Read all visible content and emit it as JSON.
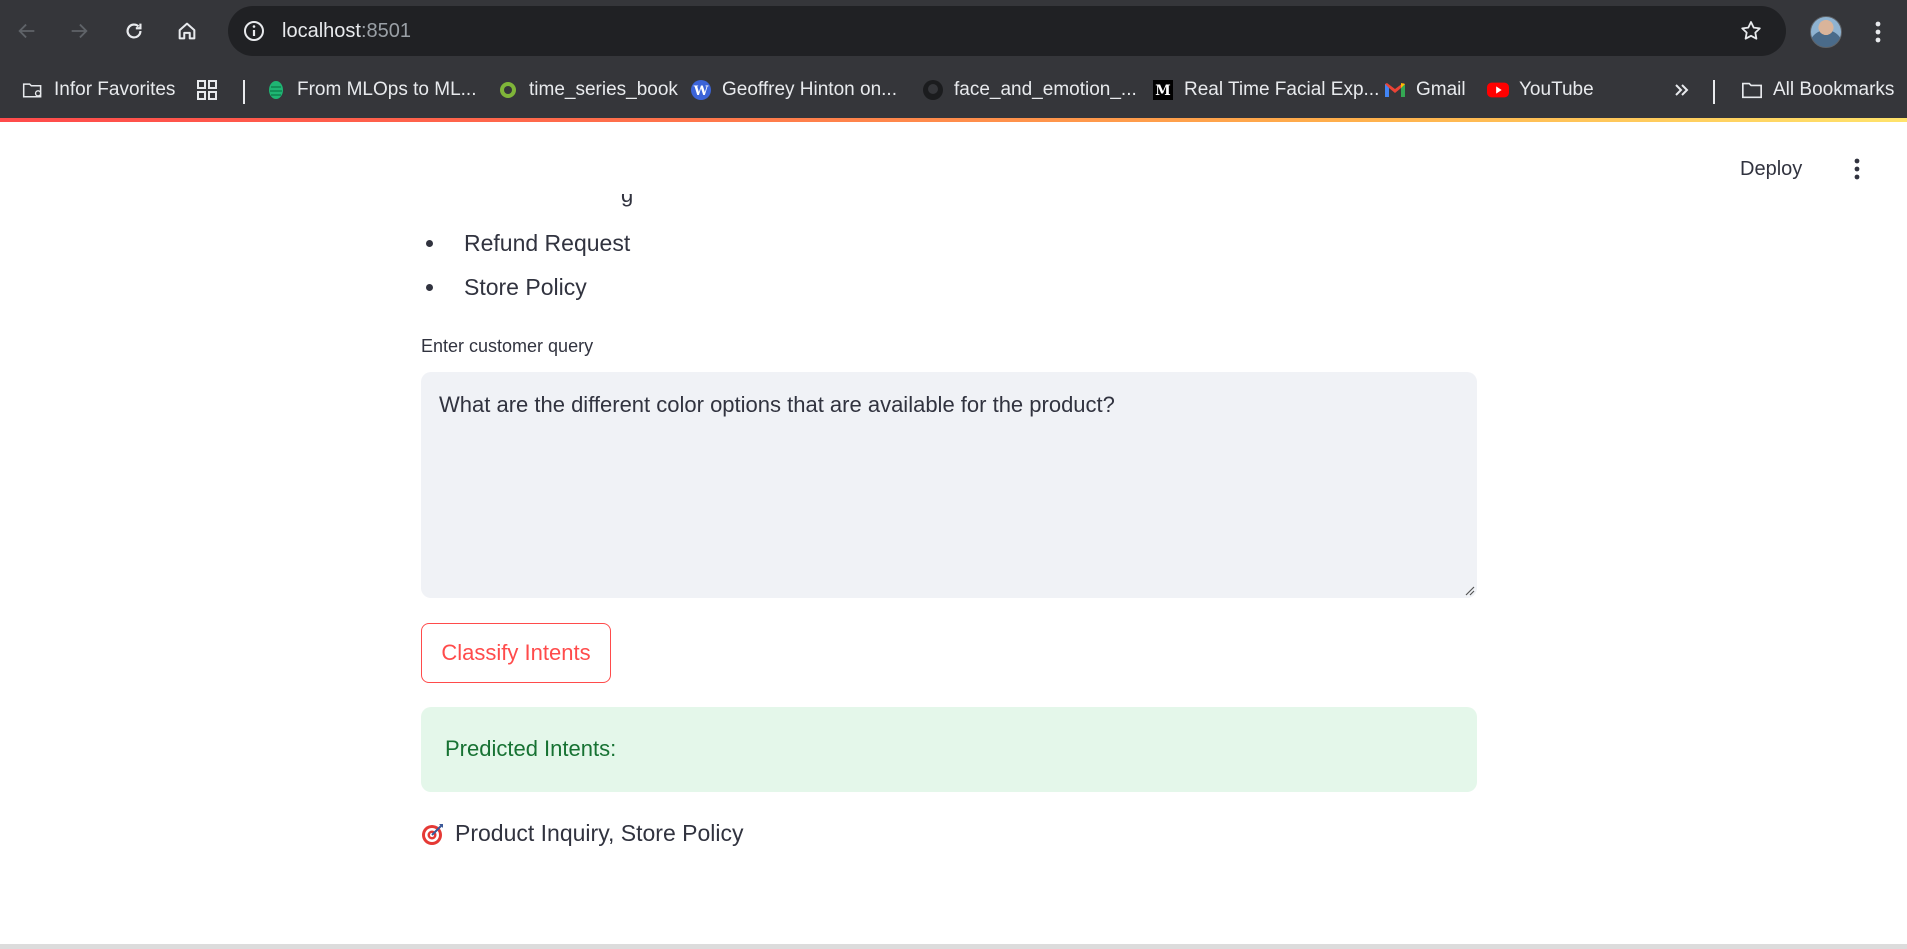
{
  "browser": {
    "url_host": "localhost",
    "url_port": ":8501",
    "bookmarks": [
      {
        "label": "Infor Favorites",
        "icon": "folder-gear-icon"
      },
      {
        "label": "From MLOps to ML...",
        "icon": "hop-icon"
      },
      {
        "label": "time_series_book",
        "icon": "ring-icon"
      },
      {
        "label": "Geoffrey Hinton on...",
        "icon": "wordpress-icon"
      },
      {
        "label": "face_and_emotion_...",
        "icon": "github-icon"
      },
      {
        "label": "Real Time Facial Exp...",
        "icon": "medium-icon"
      },
      {
        "label": "Gmail",
        "icon": "gmail-icon"
      },
      {
        "label": "YouTube",
        "icon": "youtube-icon"
      }
    ],
    "all_bookmarks_label": "All Bookmarks"
  },
  "app": {
    "deploy_label": "Deploy",
    "intent_list": [
      "Refund Request",
      "Store Policy"
    ],
    "partial_item_text": "g",
    "query_label": "Enter customer query",
    "query_value": "What are the different color options that are available for the product?",
    "classify_label": "Classify Intents",
    "success_title": "Predicted Intents:",
    "result_icon": "target-icon",
    "result_text": "Product Inquiry, Store Policy"
  },
  "colors": {
    "accent": "#ff4b4b",
    "success_bg": "#e4f7ea",
    "success_text": "#177233",
    "text": "#31333f",
    "chrome_bg": "#35363a"
  }
}
